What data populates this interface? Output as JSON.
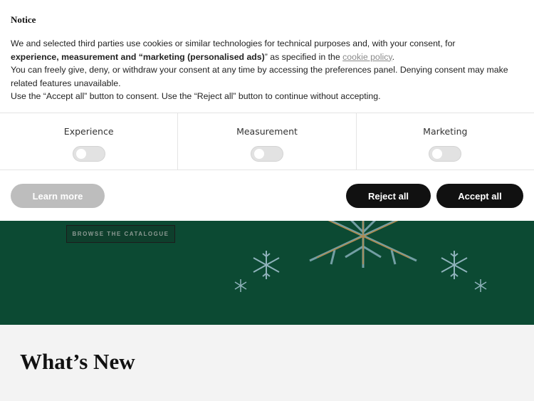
{
  "notice": {
    "title": "Notice",
    "line1_a": "We and selected third parties use cookies or similar technologies for technical purposes and, with your consent, for",
    "line2_bold": "experience, measurement and “marketing (personalised ads)",
    "line2_rest": "” as specified in the ",
    "cookie_link": "cookie policy",
    "line2_end": ".",
    "line3": "You can freely give, deny, or withdraw your consent at any time by accessing the preferences panel. Denying consent may make related features unavailable.",
    "line4": "Use the “Accept all” button to consent. Use the “Reject all” button to continue without accepting."
  },
  "preferences": [
    {
      "label": "Experience",
      "enabled": false
    },
    {
      "label": "Measurement",
      "enabled": false
    },
    {
      "label": "Marketing",
      "enabled": false
    }
  ],
  "buttons": {
    "learn_more": "Learn more",
    "reject_all": "Reject all",
    "accept_all": "Accept all"
  },
  "page": {
    "browse_label": "BROWSE THE CATALOGUE",
    "section_title": "What’s New"
  },
  "colors": {
    "hero_green": "#0c4a33",
    "button_dark": "#111111",
    "button_grey": "#bdbdbd"
  }
}
